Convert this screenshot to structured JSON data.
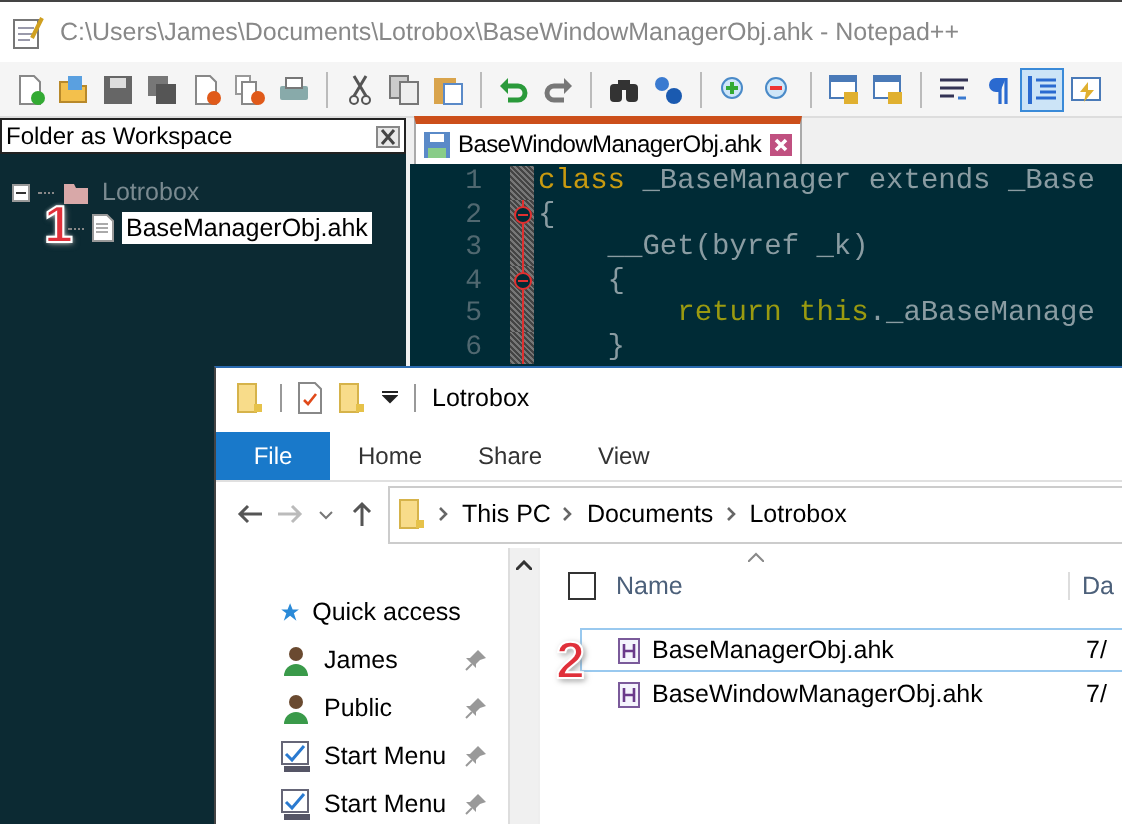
{
  "window": {
    "title": "C:\\Users\\James\\Documents\\Lotrobox\\BaseWindowManagerObj.ahk - Notepad++"
  },
  "toolbar": [
    [
      {
        "kind": "new",
        "selected": false
      },
      {
        "kind": "open",
        "selected": false
      },
      {
        "kind": "save",
        "selected": false
      },
      {
        "kind": "save_all",
        "selected": false
      },
      {
        "kind": "close",
        "selected": false
      },
      {
        "kind": "close_all",
        "selected": false
      },
      {
        "kind": "print",
        "selected": false
      }
    ],
    [
      {
        "kind": "cut",
        "selected": false
      },
      {
        "kind": "copy",
        "selected": false
      },
      {
        "kind": "paste",
        "selected": false
      }
    ],
    [
      {
        "kind": "undo",
        "selected": false
      },
      {
        "kind": "redo",
        "selected": false
      }
    ],
    [
      {
        "kind": "find",
        "selected": false
      },
      {
        "kind": "replace",
        "selected": false
      }
    ],
    [
      {
        "kind": "zoom_in",
        "selected": false
      },
      {
        "kind": "zoom_out",
        "selected": false
      }
    ],
    [
      {
        "kind": "lock_window",
        "selected": false
      },
      {
        "kind": "lock_window",
        "selected": false
      }
    ],
    [
      {
        "kind": "wrap",
        "selected": false
      },
      {
        "kind": "pilcrow",
        "selected": false
      },
      {
        "kind": "indent_guide",
        "selected": true
      },
      {
        "kind": "macro",
        "selected": false
      }
    ]
  ],
  "workspace_panel": {
    "title": "Folder as Workspace",
    "tree": [
      {
        "label": "Lotrobox",
        "expanded": true,
        "children": [
          {
            "label": "BaseManagerObj.ahk",
            "selected": true
          }
        ]
      }
    ]
  },
  "editor": {
    "tabs": [
      {
        "label": "BaseWindowManagerObj.ahk",
        "selected": true
      }
    ],
    "lines": [
      {
        "number": "1",
        "fold_start": false,
        "tokens": [
          {
            "kind": "keyword",
            "text": "class"
          },
          {
            "kind": "plain",
            "text": " _BaseManager extends _Base"
          }
        ]
      },
      {
        "number": "2",
        "fold_start": true,
        "tokens": [
          {
            "kind": "plain",
            "text": "{"
          }
        ]
      },
      {
        "number": "3",
        "fold_start": false,
        "tokens": [
          {
            "kind": "plain",
            "text": "    __Get(byref _k)"
          }
        ]
      },
      {
        "number": "4",
        "fold_start": true,
        "tokens": [
          {
            "kind": "plain",
            "text": "    {"
          }
        ]
      },
      {
        "number": "5",
        "fold_start": false,
        "tokens": [
          {
            "kind": "builtin",
            "text": "        return this"
          },
          {
            "kind": "plain",
            "text": "._aBaseManage"
          }
        ]
      },
      {
        "number": "6",
        "fold_start": false,
        "tokens": [
          {
            "kind": "plain",
            "text": "    }"
          }
        ]
      }
    ]
  },
  "explorer": {
    "title": "Lotrobox",
    "ribbon_tabs": [
      {
        "label": "File",
        "kind": "menu"
      },
      {
        "label": "Home",
        "kind": "tab"
      },
      {
        "label": "Share",
        "kind": "tab"
      },
      {
        "label": "View",
        "kind": "tab"
      }
    ],
    "breadcrumb": [
      "This PC",
      "Documents",
      "Lotrobox"
    ],
    "nav": [
      {
        "label": "Quick access",
        "kind": "star",
        "pinned": false
      },
      {
        "label": "James",
        "kind": "user",
        "pinned": true
      },
      {
        "label": "Public",
        "kind": "user",
        "pinned": true
      },
      {
        "label": "Start Menu",
        "kind": "start_menu",
        "pinned": true
      },
      {
        "label": "Start Menu",
        "kind": "start_menu",
        "pinned": true
      }
    ],
    "select_all_checked": false,
    "columns": [
      "Name",
      "Da"
    ],
    "files": [
      {
        "name": "BaseManagerObj.ahk",
        "date": "7/",
        "selected": true
      },
      {
        "name": "BaseWindowManagerObj.ahk",
        "date": "7/",
        "selected": false
      }
    ]
  },
  "annotations": [
    {
      "text": "1"
    },
    {
      "text": "2"
    }
  ]
}
